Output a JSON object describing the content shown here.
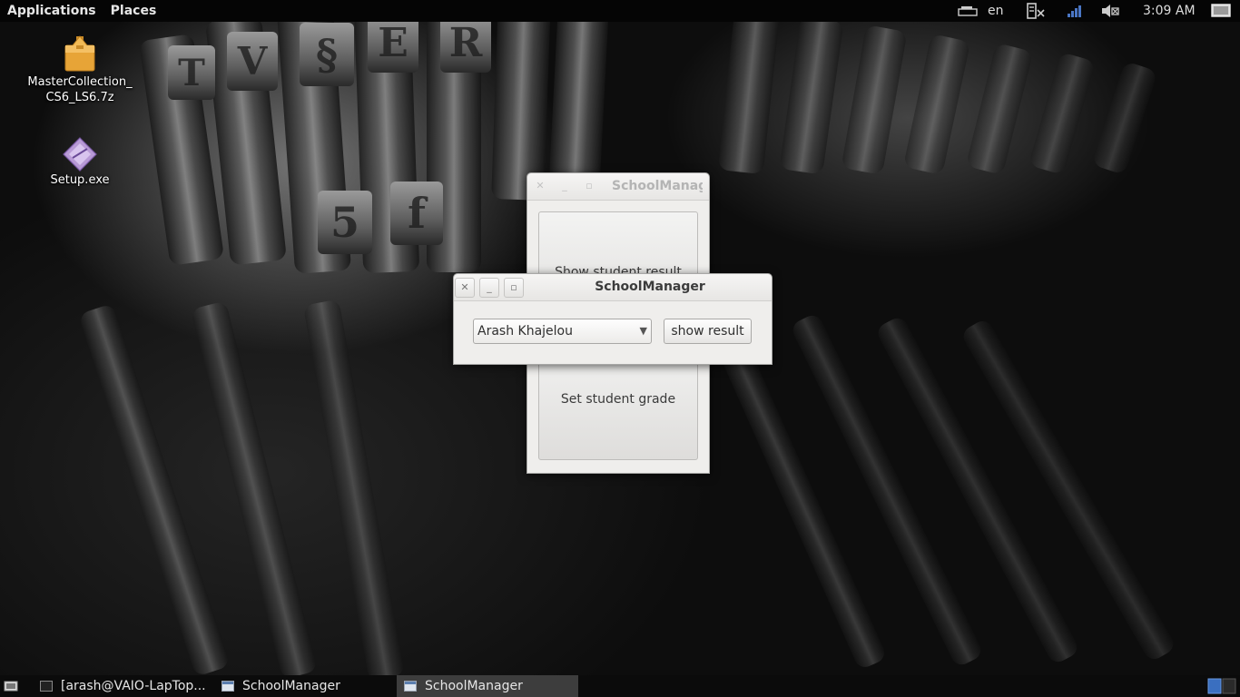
{
  "top_panel": {
    "menus": [
      "Applications",
      "Places"
    ],
    "keyboard_layout": "en",
    "clock": "3:09 AM"
  },
  "desktop_icons": [
    {
      "label_line1": "MasterCollection_",
      "label_line2": "CS6_LS6.7z",
      "icon": "archive-icon"
    },
    {
      "label_line1": "Setup.exe",
      "label_line2": "",
      "icon": "exe-icon"
    }
  ],
  "main_window": {
    "title": "SchoolManager",
    "buttons": [
      "Show student result",
      "Set student grade"
    ]
  },
  "dialog": {
    "title": "SchoolManager",
    "student_select": {
      "value": "Arash Khajelou"
    },
    "show_button": "show result"
  },
  "taskbar": {
    "tasks": [
      {
        "label": "[arash@VAIO-LapTop...",
        "icon": "terminal-icon",
        "active": false
      },
      {
        "label": "SchoolManager",
        "icon": "window-icon",
        "active": false
      },
      {
        "label": "SchoolManager",
        "icon": "window-icon",
        "active": true
      }
    ]
  },
  "colors": {
    "panel_bg": "#050505",
    "window_bg": "#efeeec",
    "active_task_bg": "#3d3d3d"
  }
}
